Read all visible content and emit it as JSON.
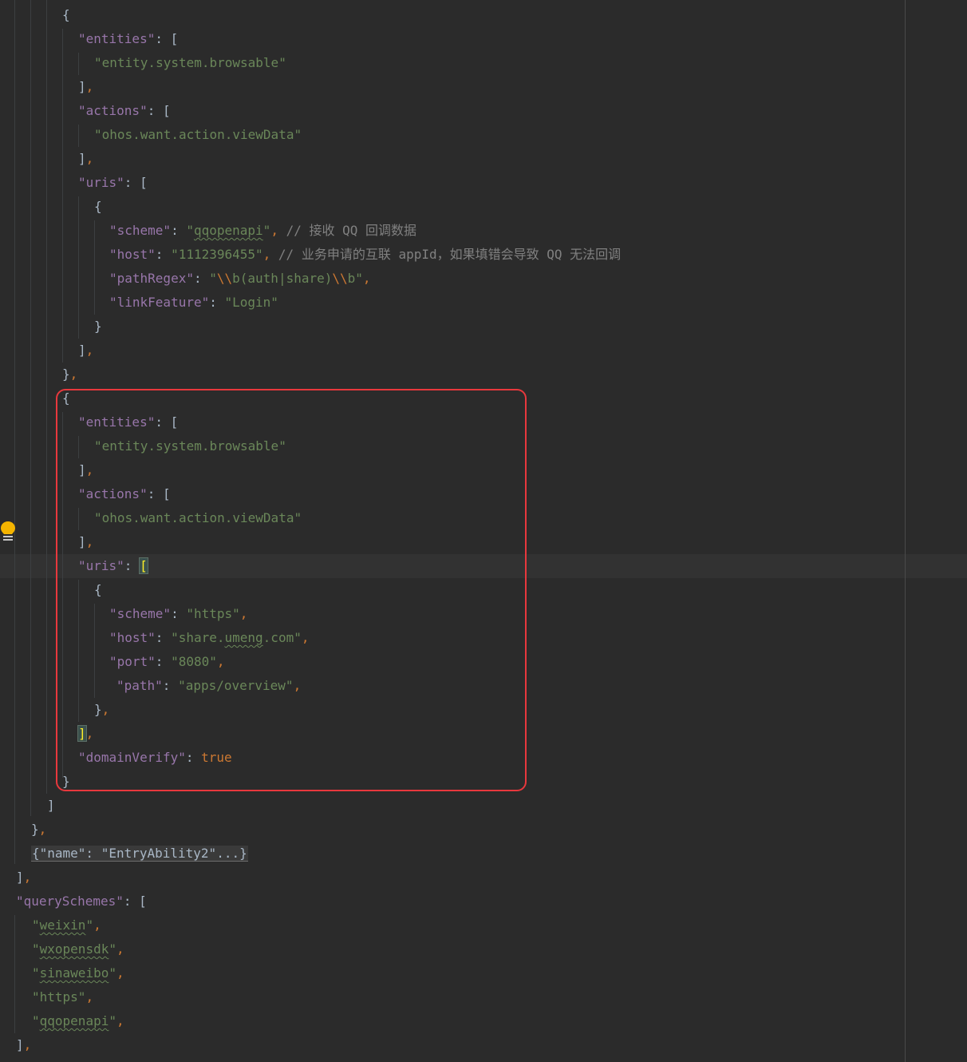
{
  "editor": {
    "lines": [
      {
        "parts": [
          {
            "t": "{",
            "c": "p"
          }
        ]
      },
      {
        "parts": [
          {
            "t": "\"entities\"",
            "c": "k"
          },
          {
            "t": ": [",
            "c": "p"
          }
        ]
      },
      {
        "parts": [
          {
            "t": "\"entity.system.browsable\"",
            "c": "s"
          }
        ]
      },
      {
        "parts": [
          {
            "t": "]",
            "c": "p"
          },
          {
            "t": ",",
            "c": "comma"
          }
        ]
      },
      {
        "parts": [
          {
            "t": "\"actions\"",
            "c": "k"
          },
          {
            "t": ": [",
            "c": "p"
          }
        ]
      },
      {
        "parts": [
          {
            "t": "\"ohos.want.action.viewData\"",
            "c": "s"
          }
        ]
      },
      {
        "parts": [
          {
            "t": "]",
            "c": "p"
          },
          {
            "t": ",",
            "c": "comma"
          }
        ]
      },
      {
        "parts": [
          {
            "t": "\"uris\"",
            "c": "k"
          },
          {
            "t": ": [",
            "c": "p"
          }
        ]
      },
      {
        "parts": [
          {
            "t": "{",
            "c": "p"
          }
        ]
      },
      {
        "parts": [
          {
            "t": "\"scheme\"",
            "c": "k"
          },
          {
            "t": ": ",
            "c": "p"
          },
          {
            "t": "\"",
            "c": "s"
          },
          {
            "t": "qqopenapi",
            "c": "s typo"
          },
          {
            "t": "\"",
            "c": "s"
          },
          {
            "t": ", ",
            "c": "comma"
          },
          {
            "t": "// 接收 QQ 回调数据",
            "c": "c"
          }
        ]
      },
      {
        "parts": [
          {
            "t": "\"host\"",
            "c": "k"
          },
          {
            "t": ": ",
            "c": "p"
          },
          {
            "t": "\"1112396455\"",
            "c": "s"
          },
          {
            "t": ", ",
            "c": "comma"
          },
          {
            "t": "// 业务申请的互联 appId，如果填错会导致 QQ 无法回调",
            "c": "c"
          }
        ]
      },
      {
        "parts": [
          {
            "t": "\"pathRegex\"",
            "c": "k"
          },
          {
            "t": ": ",
            "c": "p"
          },
          {
            "t": "\"",
            "c": "s"
          },
          {
            "t": "\\\\",
            "c": "kw"
          },
          {
            "t": "b(auth|share)",
            "c": "s"
          },
          {
            "t": "\\\\",
            "c": "kw"
          },
          {
            "t": "b\"",
            "c": "s"
          },
          {
            "t": ",",
            "c": "comma"
          }
        ]
      },
      {
        "parts": [
          {
            "t": "\"linkFeature\"",
            "c": "k"
          },
          {
            "t": ": ",
            "c": "p"
          },
          {
            "t": "\"Login\"",
            "c": "s"
          }
        ]
      },
      {
        "parts": [
          {
            "t": "}",
            "c": "p"
          }
        ]
      },
      {
        "parts": [
          {
            "t": "]",
            "c": "p"
          },
          {
            "t": ",",
            "c": "comma"
          }
        ]
      },
      {
        "parts": [
          {
            "t": "}",
            "c": "p"
          },
          {
            "t": ",",
            "c": "comma"
          }
        ]
      },
      {
        "parts": [
          {
            "t": "{",
            "c": "p"
          }
        ]
      },
      {
        "parts": [
          {
            "t": "\"entities\"",
            "c": "k"
          },
          {
            "t": ": [",
            "c": "p"
          }
        ]
      },
      {
        "parts": [
          {
            "t": "\"entity.system.browsable\"",
            "c": "s"
          }
        ]
      },
      {
        "parts": [
          {
            "t": "]",
            "c": "p"
          },
          {
            "t": ",",
            "c": "comma"
          }
        ]
      },
      {
        "parts": [
          {
            "t": "\"actions\"",
            "c": "k"
          },
          {
            "t": ": [",
            "c": "p"
          }
        ]
      },
      {
        "parts": [
          {
            "t": "\"ohos.want.action.viewData\"",
            "c": "s"
          }
        ]
      },
      {
        "parts": [
          {
            "t": "]",
            "c": "p"
          },
          {
            "t": ",",
            "c": "comma"
          }
        ]
      },
      {
        "parts": [
          {
            "t": "\"uris\"",
            "c": "k"
          },
          {
            "t": ": ",
            "c": "p"
          },
          {
            "t": "[",
            "c": "match"
          }
        ]
      },
      {
        "parts": [
          {
            "t": "{",
            "c": "p"
          }
        ]
      },
      {
        "parts": [
          {
            "t": "\"scheme\"",
            "c": "k"
          },
          {
            "t": ": ",
            "c": "p"
          },
          {
            "t": "\"https\"",
            "c": "s"
          },
          {
            "t": ",",
            "c": "comma"
          }
        ]
      },
      {
        "parts": [
          {
            "t": "\"host\"",
            "c": "k"
          },
          {
            "t": ": ",
            "c": "p"
          },
          {
            "t": "\"share.",
            "c": "s"
          },
          {
            "t": "umeng",
            "c": "s typo"
          },
          {
            "t": ".com\"",
            "c": "s"
          },
          {
            "t": ",",
            "c": "comma"
          }
        ]
      },
      {
        "parts": [
          {
            "t": "\"port\"",
            "c": "k"
          },
          {
            "t": ": ",
            "c": "p"
          },
          {
            "t": "\"8080\"",
            "c": "s"
          },
          {
            "t": ",",
            "c": "comma"
          }
        ]
      },
      {
        "parts": [
          {
            "t": "\"path\"",
            "c": "k"
          },
          {
            "t": ": ",
            "c": "p"
          },
          {
            "t": "\"apps/overview\"",
            "c": "s"
          },
          {
            "t": ",",
            "c": "comma"
          }
        ]
      },
      {
        "parts": [
          {
            "t": "}",
            "c": "p"
          },
          {
            "t": ",",
            "c": "comma"
          }
        ]
      },
      {
        "parts": [
          {
            "t": "]",
            "c": "match"
          },
          {
            "t": ",",
            "c": "comma"
          }
        ]
      },
      {
        "parts": [
          {
            "t": "\"domainVerify\"",
            "c": "k"
          },
          {
            "t": ": ",
            "c": "p"
          },
          {
            "t": "true",
            "c": "kw"
          }
        ]
      },
      {
        "parts": [
          {
            "t": "}",
            "c": "p"
          }
        ]
      },
      {
        "parts": [
          {
            "t": "]",
            "c": "p"
          }
        ]
      },
      {
        "parts": [
          {
            "t": "}",
            "c": "p"
          },
          {
            "t": ",",
            "c": "comma"
          }
        ]
      },
      {
        "parts": [
          {
            "t": "{\"name\": \"EntryAbility2\"...}",
            "c": "fold"
          }
        ]
      },
      {
        "parts": [
          {
            "t": "]",
            "c": "p"
          },
          {
            "t": ",",
            "c": "comma"
          }
        ]
      },
      {
        "parts": [
          {
            "t": "\"querySchemes\"",
            "c": "k"
          },
          {
            "t": ": [",
            "c": "p"
          }
        ]
      },
      {
        "parts": [
          {
            "t": "\"",
            "c": "s"
          },
          {
            "t": "weixin",
            "c": "s typo"
          },
          {
            "t": "\"",
            "c": "s"
          },
          {
            "t": ",",
            "c": "comma"
          }
        ]
      },
      {
        "parts": [
          {
            "t": "\"",
            "c": "s"
          },
          {
            "t": "wxopensdk",
            "c": "s typo"
          },
          {
            "t": "\"",
            "c": "s"
          },
          {
            "t": ",",
            "c": "comma"
          }
        ]
      },
      {
        "parts": [
          {
            "t": "\"",
            "c": "s"
          },
          {
            "t": "sinaweibo",
            "c": "s typo"
          },
          {
            "t": "\"",
            "c": "s"
          },
          {
            "t": ",",
            "c": "comma"
          }
        ]
      },
      {
        "parts": [
          {
            "t": "\"https\"",
            "c": "s"
          },
          {
            "t": ",",
            "c": "comma"
          }
        ]
      },
      {
        "parts": [
          {
            "t": "\"",
            "c": "s"
          },
          {
            "t": "qqopenapi",
            "c": "s typo"
          },
          {
            "t": "\"",
            "c": "s"
          },
          {
            "t": ",",
            "c": "comma"
          }
        ]
      },
      {
        "parts": [
          {
            "t": "]",
            "c": "p"
          },
          {
            "t": ",",
            "c": "comma"
          }
        ]
      }
    ]
  },
  "colors": {
    "background": "#2b2b2b",
    "key": "#9876aa",
    "string": "#6a8759",
    "comment": "#808080",
    "punctuation": "#a9b7c6",
    "keyword": "#cc7832",
    "highlight_border": "#e8383d",
    "bulb": "#f4b400"
  },
  "icons": {
    "gutter_icon": "lightbulb-icon"
  }
}
